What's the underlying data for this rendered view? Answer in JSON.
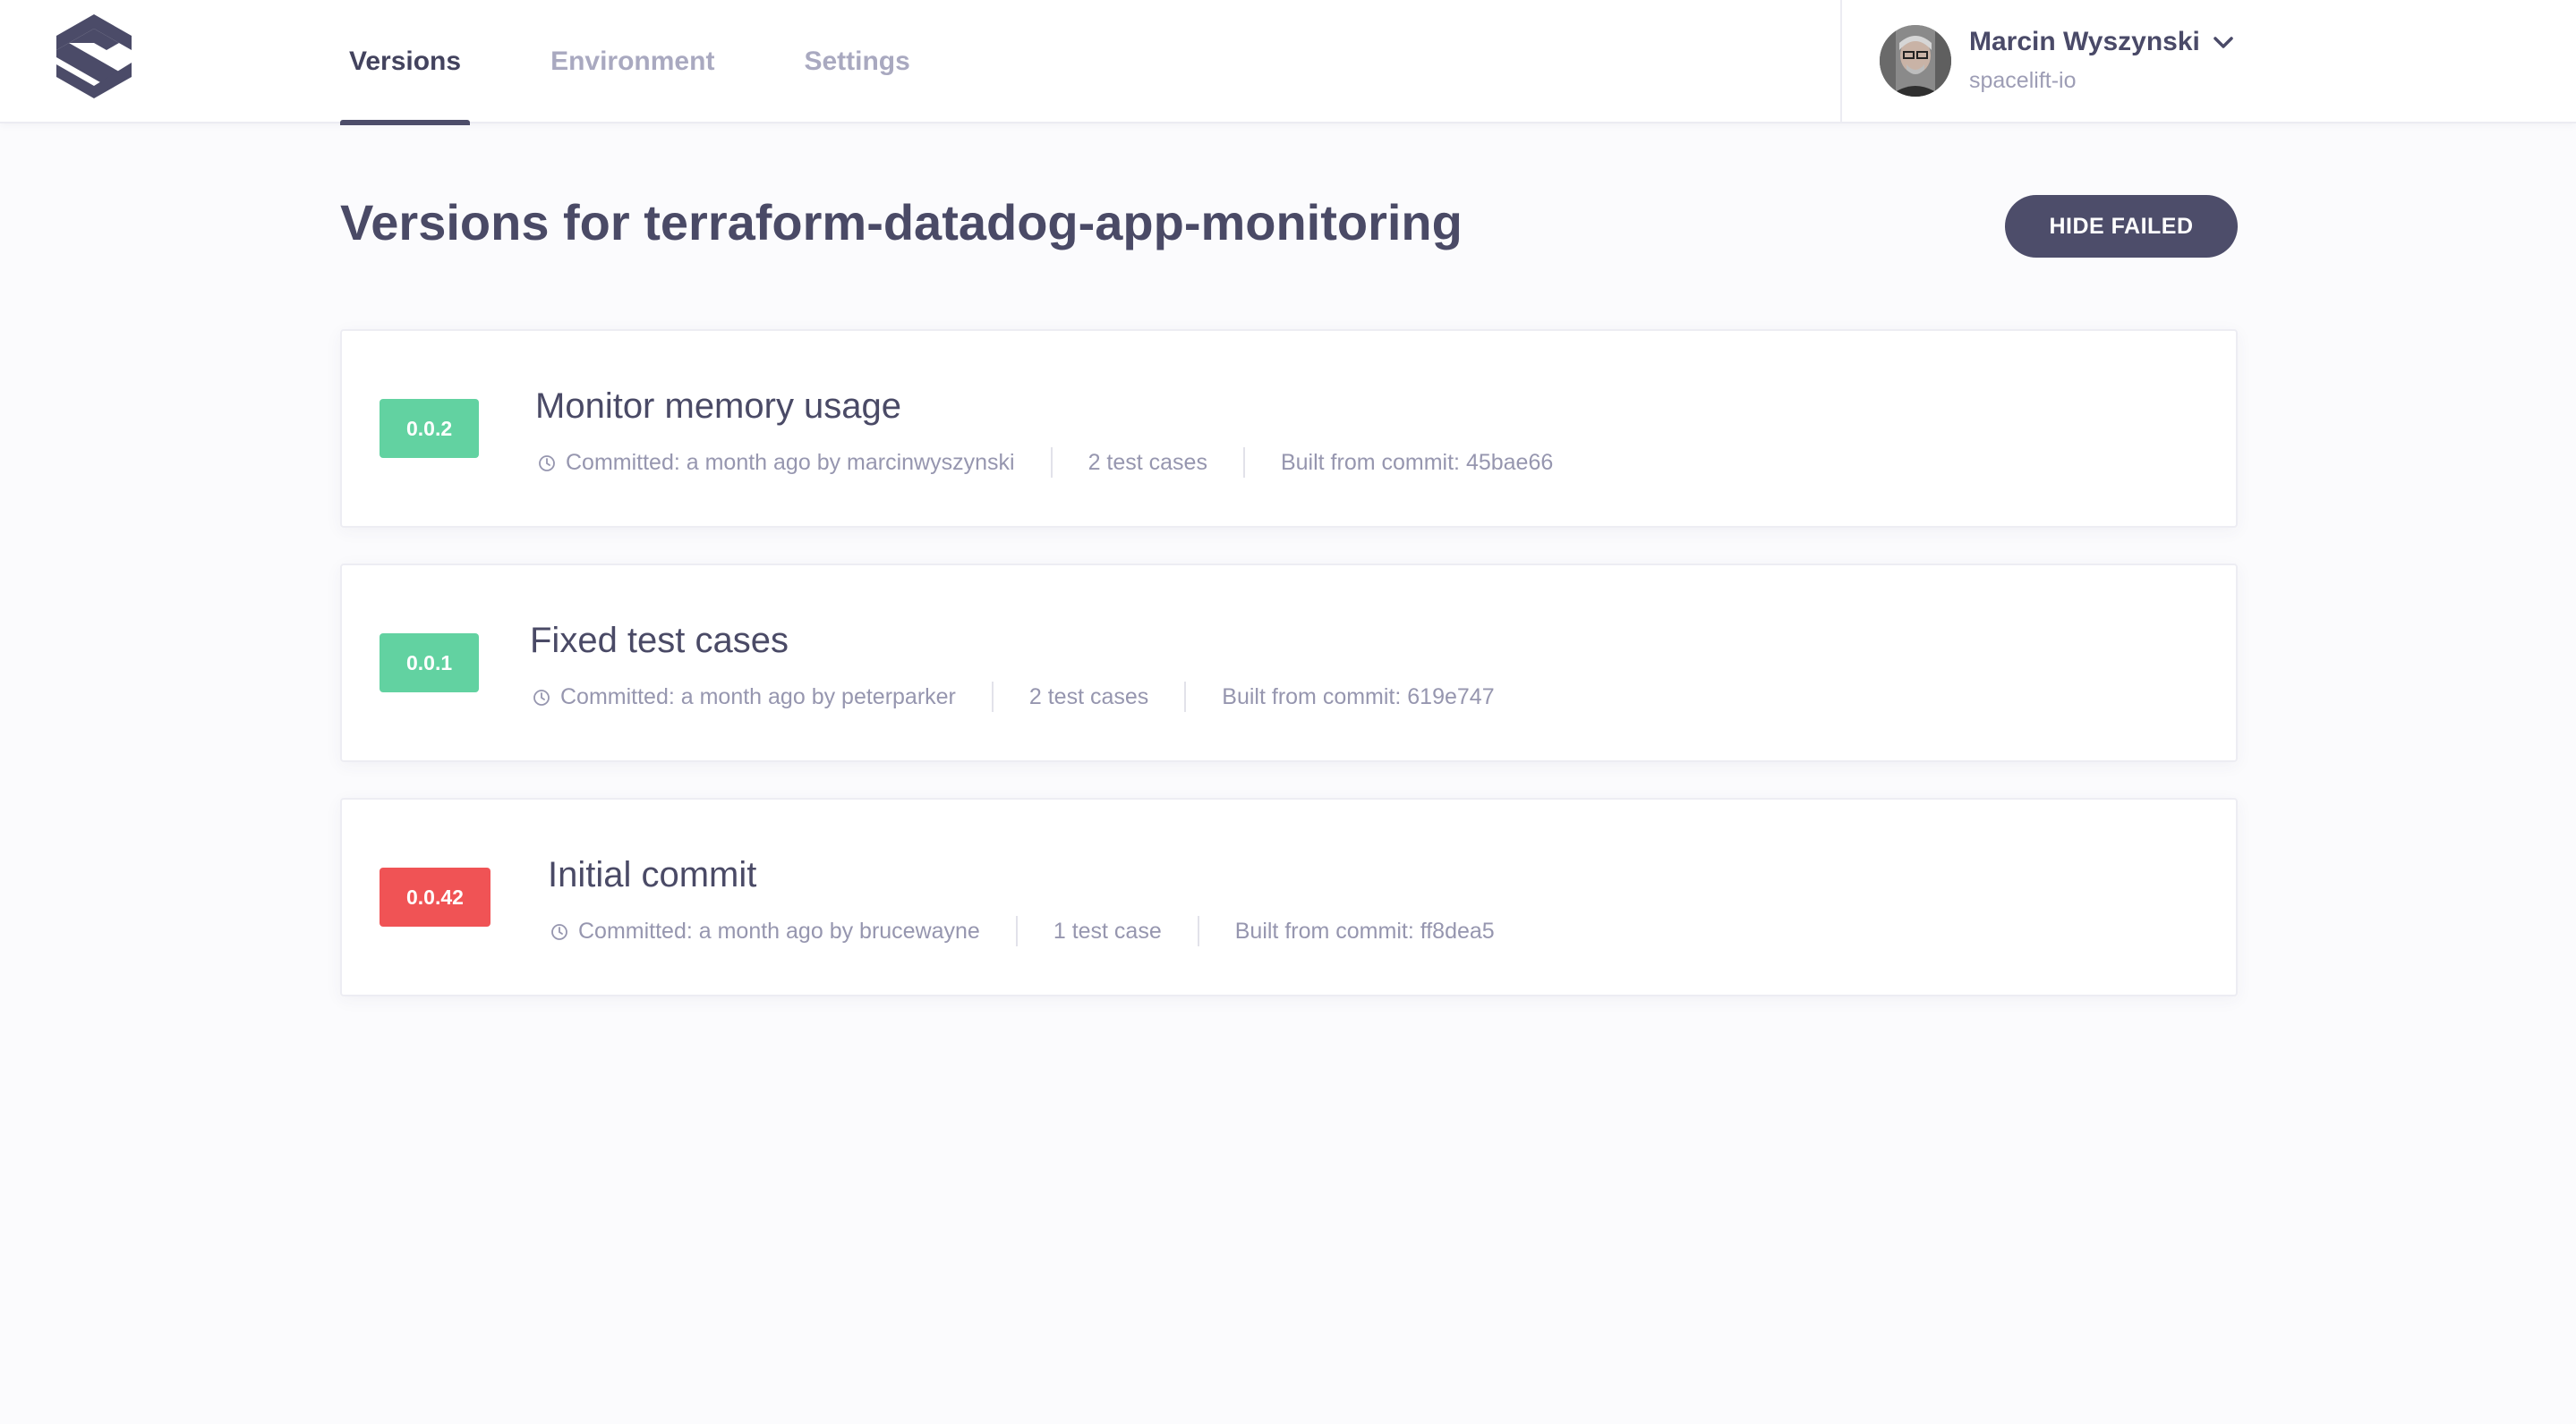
{
  "header": {
    "tabs": [
      {
        "label": "Versions",
        "active": true
      },
      {
        "label": "Environment",
        "active": false
      },
      {
        "label": "Settings",
        "active": false
      }
    ],
    "user": {
      "name": "Marcin Wyszynski",
      "org": "spacelift-io"
    }
  },
  "main": {
    "title": "Versions for terraform-datadog-app-monitoring",
    "hide_failed_label": "HIDE FAILED",
    "versions": [
      {
        "version": "0.0.2",
        "status": "success",
        "title": "Monitor memory usage",
        "committed": "Committed: a month ago by marcinwyszynski",
        "test_cases": "2 test cases",
        "commit": "Built from commit: 45bae66"
      },
      {
        "version": "0.0.1",
        "status": "success",
        "title": "Fixed test cases",
        "committed": "Committed: a month ago by peterparker",
        "test_cases": "2 test cases",
        "commit": "Built from commit: 619e747"
      },
      {
        "version": "0.0.42",
        "status": "failed",
        "title": "Initial commit",
        "committed": "Committed: a month ago by brucewayne",
        "test_cases": "1 test case",
        "commit": "Built from commit: ff8dea5"
      }
    ]
  },
  "colors": {
    "primary": "#4d4d6a",
    "success": "#62d2a1",
    "failed": "#f05355",
    "muted_text": "#9696af"
  }
}
